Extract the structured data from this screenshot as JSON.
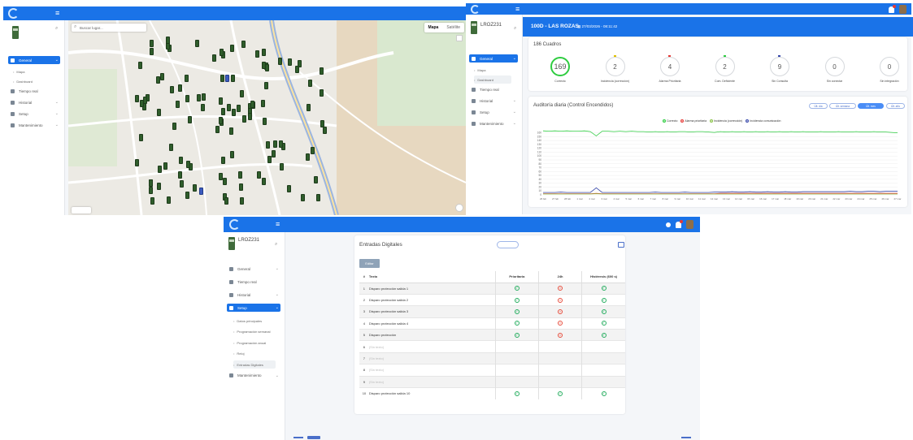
{
  "brand": {
    "primary": "#1a73e8",
    "ok": "#27ae60",
    "alert": "#e74c3c"
  },
  "map_screen": {
    "sidebar": {
      "items": [
        {
          "label": "General",
          "icon": "building-icon",
          "active": true
        },
        {
          "label": "Mapa",
          "sub": true
        },
        {
          "label": "Dashboard",
          "sub": true
        },
        {
          "label": "Tiempo real",
          "icon": "antenna-icon"
        },
        {
          "label": "Historial",
          "icon": "building-icon"
        },
        {
          "label": "Setup",
          "icon": "grid-icon"
        },
        {
          "label": "Mantenimiento",
          "icon": "wrench-icon"
        }
      ]
    },
    "search_placeholder": "Buscar lugar...",
    "map_type": {
      "map": "Mapa",
      "satellite": "Satélite"
    }
  },
  "dashboard_screen": {
    "sidebar": {
      "id": "LROZ231",
      "items": [
        {
          "label": "General",
          "active": true
        },
        {
          "label": "Mapa",
          "sub": true
        },
        {
          "label": "Dashboard",
          "sub": true,
          "selected": true
        },
        {
          "label": "Tiempo real"
        },
        {
          "label": "Historial"
        },
        {
          "label": "Setup"
        },
        {
          "label": "Mantenimiento"
        }
      ]
    },
    "header": {
      "title": "100D - LAS ROZAS",
      "datetime": "27/03/2026 - 08:11:42"
    },
    "summary": {
      "title": "186 Cuadros",
      "rings": [
        {
          "value": "169",
          "label": "Correcto",
          "highlight": true
        },
        {
          "value": "2",
          "label": "Incidencia (corrección)"
        },
        {
          "value": "4",
          "label": "Alarma Prioritaria"
        },
        {
          "value": "2",
          "label": "Com. Deficiente"
        },
        {
          "value": "9",
          "label": "Sin Consulta"
        },
        {
          "value": "0",
          "label": "Sin conectar"
        },
        {
          "value": "0",
          "label": "Sin integración"
        }
      ]
    },
    "chart_data": {
      "type": "line",
      "title": "Auditoría diaria (Control Encendidos)",
      "buttons": [
        "Últ. día",
        "Últ. semana",
        "Últ. mes",
        "Últ. año"
      ],
      "active_button": 2,
      "ylim": [
        0,
        180
      ],
      "y_ticks": [
        0,
        10,
        20,
        30,
        40,
        50,
        60,
        70,
        80,
        90,
        100,
        110,
        120,
        130,
        140,
        150,
        160
      ],
      "x_ticks": [
        "26 feb",
        "27 feb",
        "28 feb",
        "1 mar",
        "2 mar",
        "3 mar",
        "4 mar",
        "5 mar",
        "6 mar",
        "7 mar",
        "8 mar",
        "9 mar",
        "10 mar",
        "11 mar",
        "12 mar",
        "13 mar",
        "14 mar",
        "15 mar",
        "16 mar",
        "17 mar",
        "18 mar",
        "19 mar",
        "20 mar",
        "21 mar",
        "22 mar",
        "23 mar",
        "24 mar",
        "25 mar",
        "26 mar",
        "27 mar"
      ],
      "series": [
        {
          "name": "Correcto",
          "color": "#2ecc40",
          "values": [
            165,
            164,
            165,
            164,
            165,
            164,
            164,
            165,
            163,
            152,
            164,
            164,
            163,
            164,
            163,
            164,
            163,
            163,
            162,
            163,
            162,
            163,
            162,
            163,
            163,
            162,
            163,
            163,
            162,
            161,
            163,
            162,
            163,
            162,
            163,
            162,
            163,
            162,
            163,
            162,
            163,
            162,
            163,
            162,
            163,
            162,
            162,
            163,
            162,
            162,
            163,
            162,
            162,
            163,
            162,
            162,
            163,
            162,
            162,
            161,
            160
          ]
        },
        {
          "name": "Alarma prioritaria",
          "color": "#e53935",
          "values": [
            3,
            3,
            3,
            3,
            3,
            3,
            3,
            3,
            3,
            4,
            3,
            3,
            3,
            3,
            3,
            3,
            3,
            3,
            3,
            3,
            3,
            3,
            3,
            3,
            3,
            3,
            3,
            3,
            3,
            3,
            4,
            4,
            4,
            4,
            4,
            4,
            4,
            4,
            4,
            4,
            4,
            4,
            4,
            4,
            4,
            4,
            4,
            4,
            4,
            4,
            4,
            4,
            4,
            4,
            4,
            4,
            4,
            4,
            4,
            4,
            4
          ]
        },
        {
          "name": "Incidencia (corrección)",
          "color": "#8bc34a",
          "values": [
            2,
            2,
            2,
            2,
            2,
            2,
            2,
            2,
            2,
            3,
            2,
            2,
            2,
            2,
            2,
            2,
            2,
            2,
            2,
            2,
            2,
            2,
            2,
            2,
            2,
            2,
            2,
            2,
            2,
            2,
            2,
            2,
            2,
            2,
            2,
            2,
            2,
            2,
            2,
            2,
            2,
            2,
            2,
            2,
            2,
            2,
            2,
            2,
            2,
            2,
            2,
            2,
            2,
            2,
            2,
            2,
            2,
            2,
            2,
            2,
            2
          ]
        },
        {
          "name": "Incidencia comunicación",
          "color": "#3949ab",
          "values": [
            6,
            6,
            6,
            7,
            6,
            6,
            6,
            6,
            6,
            18,
            6,
            6,
            6,
            6,
            6,
            6,
            6,
            6,
            6,
            7,
            6,
            6,
            6,
            6,
            7,
            6,
            6,
            6,
            6,
            7,
            7,
            7,
            8,
            7,
            7,
            8,
            7,
            7,
            8,
            7,
            7,
            8,
            7,
            7,
            8,
            8,
            8,
            8,
            8,
            8,
            8,
            8,
            9,
            8,
            8,
            9,
            9,
            8,
            9,
            9,
            9
          ]
        }
      ]
    }
  },
  "inputs_screen": {
    "sidebar": {
      "id": "LROZ231",
      "items": [
        {
          "label": "General"
        },
        {
          "label": "Tiempo real"
        },
        {
          "label": "Historial"
        },
        {
          "label": "Setup",
          "active": true
        },
        {
          "label": "Datos principales",
          "sub": true
        },
        {
          "label": "Programación semanal",
          "sub": true
        },
        {
          "label": "Programación anual",
          "sub": true
        },
        {
          "label": "Reloj",
          "sub": true
        },
        {
          "label": "Entradas Digitales",
          "sub": true,
          "selected": true
        },
        {
          "label": "Mantenimiento"
        }
      ]
    },
    "page_title": "Entradas Digitales",
    "edit_button": "Editar",
    "columns": [
      "#",
      "Texto",
      "Prioritaria",
      "24h",
      "Histéresis (600 s)"
    ],
    "rows": [
      {
        "n": "1",
        "text": "Disparo protección salida 1",
        "prio": "ok",
        "h24": "bad",
        "hist": "ok"
      },
      {
        "n": "2",
        "text": "Disparo protección salida 2",
        "prio": "ok",
        "h24": "bad",
        "hist": "ok"
      },
      {
        "n": "3",
        "text": "Disparo protección salida 3",
        "prio": "ok",
        "h24": "bad",
        "hist": "ok"
      },
      {
        "n": "4",
        "text": "Disparo protección salida 4",
        "prio": "ok",
        "h24": "bad",
        "hist": "ok"
      },
      {
        "n": "5",
        "text": "Disparo protección",
        "prio": "ok",
        "h24": "bad",
        "hist": "ok"
      },
      {
        "n": "6",
        "text": "(Sin texto)",
        "muted": true
      },
      {
        "n": "7",
        "text": "(Sin texto)",
        "muted": true
      },
      {
        "n": "8",
        "text": "(Sin texto)",
        "muted": true
      },
      {
        "n": "9",
        "text": "(Sin texto)",
        "muted": true
      },
      {
        "n": "10",
        "text": "Disparo protección salida 10",
        "prio": "ok",
        "h24": "ok",
        "hist": "ok"
      }
    ]
  }
}
